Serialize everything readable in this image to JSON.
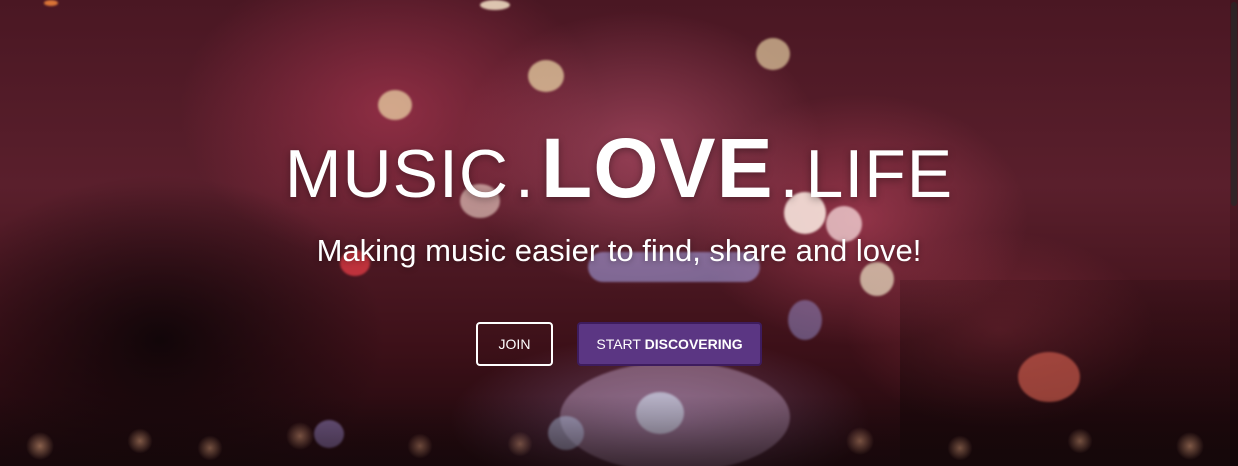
{
  "hero": {
    "headline": {
      "word1": "MUSIC",
      "sep1": ".",
      "word2": "LOVE",
      "sep2": ".",
      "word3": "LIFE"
    },
    "tagline": "Making music easier to find, share and love!",
    "buttons": {
      "join_label": "JOIN",
      "start_prefix": "START",
      "start_emphasis": "DISCOVERING"
    }
  },
  "colors": {
    "accent": "#5b3683",
    "accent_border": "#3e1c5e",
    "text": "#ffffff"
  }
}
